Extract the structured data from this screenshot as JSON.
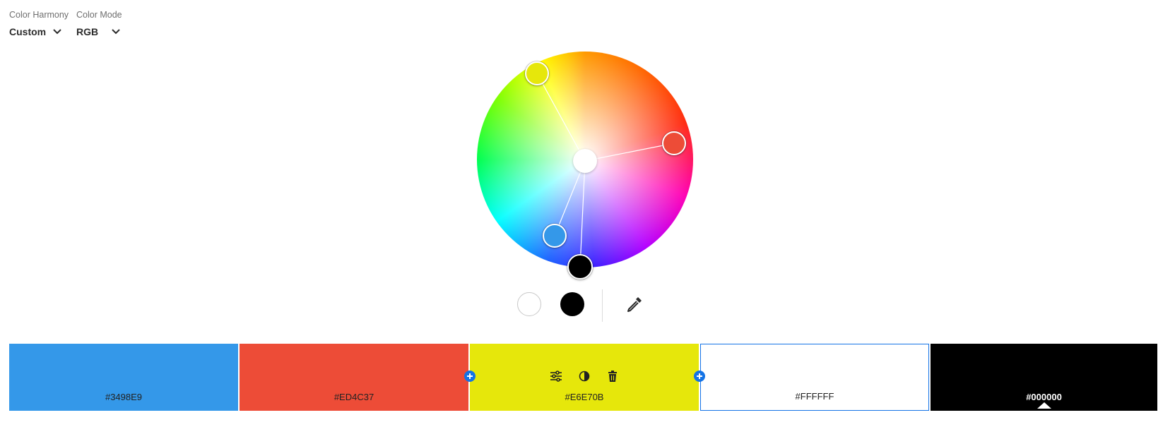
{
  "controls": {
    "harmony": {
      "label": "Color Harmony",
      "value": "Custom"
    },
    "mode": {
      "label": "Color Mode",
      "value": "RGB"
    }
  },
  "wheel": {
    "handles": [
      {
        "name": "yellow",
        "color": "#E6E70B"
      },
      {
        "name": "red",
        "color": "#ED4C37"
      },
      {
        "name": "blue",
        "color": "#3498E9"
      },
      {
        "name": "black",
        "color": "#000000"
      },
      {
        "name": "white",
        "color": "#FFFFFF"
      }
    ]
  },
  "tools": {
    "white": "#FFFFFF",
    "black": "#000000",
    "eyedropper_icon": "eyedropper-icon"
  },
  "palette": {
    "swatches": [
      {
        "hex": "#3498E9",
        "color": "#3498E9",
        "text_color": "#222222"
      },
      {
        "hex": "#ED4C37",
        "color": "#ED4C37",
        "text_color": "#222222"
      },
      {
        "hex": "#E6E70B",
        "color": "#E6E70B",
        "text_color": "#222222"
      },
      {
        "hex": "#FFFFFF",
        "color": "#FFFFFF",
        "text_color": "#222222"
      },
      {
        "hex": "#000000",
        "color": "#000000",
        "text_color": "#FFFFFF"
      }
    ],
    "selected_index": 4,
    "accent": "#1473E6"
  }
}
